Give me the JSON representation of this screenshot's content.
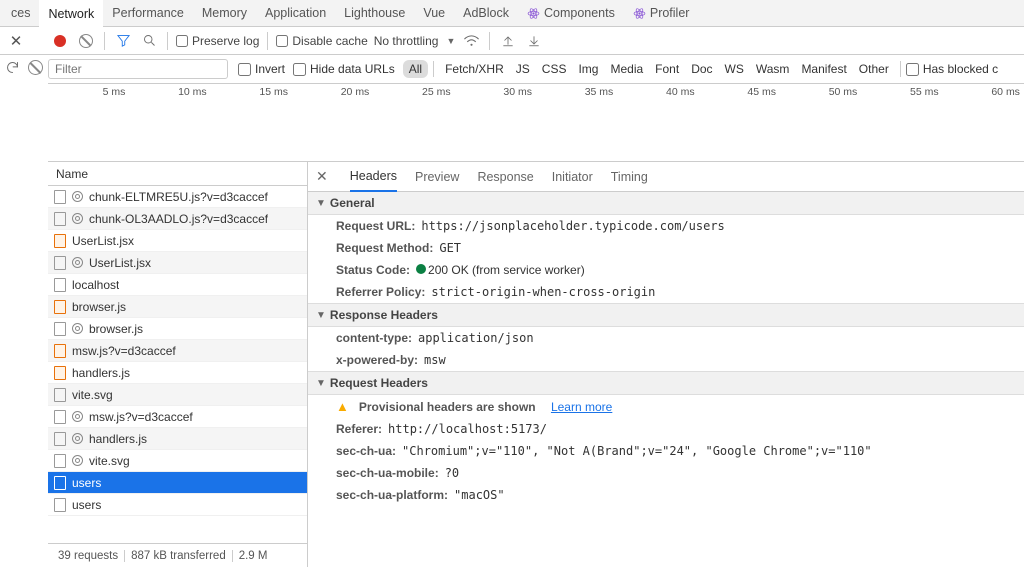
{
  "topTabs": {
    "t0": "ces",
    "t1": "Network",
    "t2": "Performance",
    "t3": "Memory",
    "t4": "Application",
    "t5": "Lighthouse",
    "t6": "Vue",
    "t7": "AdBlock",
    "t8": "Components",
    "t9": "Profiler"
  },
  "toolbar": {
    "preserve": "Preserve log",
    "disableCache": "Disable cache",
    "throttling": "No throttling"
  },
  "filter": {
    "placeholder": "Filter",
    "invert": "Invert",
    "hideData": "Hide data URLs",
    "types": {
      "all": "All",
      "fx": "Fetch/XHR",
      "js": "JS",
      "css": "CSS",
      "img": "Img",
      "media": "Media",
      "font": "Font",
      "doc": "Doc",
      "ws": "WS",
      "wasm": "Wasm",
      "manifest": "Manifest",
      "other": "Other"
    },
    "blocked": "Has blocked c"
  },
  "ticks": {
    "t1": "5 ms",
    "t2": "10 ms",
    "t3": "15 ms",
    "t4": "20 ms",
    "t5": "25 ms",
    "t6": "30 ms",
    "t7": "35 ms",
    "t8": "40 ms",
    "t9": "45 ms",
    "t10": "50 ms",
    "t11": "55 ms",
    "t12": "60 ms"
  },
  "reqHeader": "Name",
  "reqs": {
    "r0": "chunk-ELTMRE5U.js?v=d3caccef",
    "r1": "chunk-OL3AADLO.js?v=d3caccef",
    "r2": "UserList.jsx",
    "r3": "UserList.jsx",
    "r4": "localhost",
    "r5": "browser.js",
    "r6": "browser.js",
    "r7": "msw.js?v=d3caccef",
    "r8": "handlers.js",
    "r9": "vite.svg",
    "r10": "msw.js?v=d3caccef",
    "r11": "handlers.js",
    "r12": "vite.svg",
    "r13": "users",
    "r14": "users"
  },
  "footer": {
    "count": "39 requests",
    "xfer": "887 kB transferred",
    "more": "2.9 M"
  },
  "detailTabs": {
    "headers": "Headers",
    "preview": "Preview",
    "response": "Response",
    "initiator": "Initiator",
    "timing": "Timing"
  },
  "sections": {
    "general": "General",
    "resp": "Response Headers",
    "req": "Request Headers"
  },
  "general": {
    "urlK": "Request URL:",
    "urlV": "https://jsonplaceholder.typicode.com/users",
    "methodK": "Request Method:",
    "methodV": "GET",
    "statusK": "Status Code:",
    "statusV": "200 OK (from service worker)",
    "refK": "Referrer Policy:",
    "refV": "strict-origin-when-cross-origin"
  },
  "respH": {
    "ctK": "content-type:",
    "ctV": "application/json",
    "xpK": "x-powered-by:",
    "xpV": "msw"
  },
  "reqH": {
    "prov": "Provisional headers are shown",
    "learn": "Learn more",
    "refK": "Referer:",
    "refV": "http://localhost:5173/",
    "uaK": "sec-ch-ua:",
    "uaV": "\"Chromium\";v=\"110\", \"Not A(Brand\";v=\"24\", \"Google Chrome\";v=\"110\"",
    "mobK": "sec-ch-ua-mobile:",
    "mobV": "?0",
    "platK": "sec-ch-ua-platform:",
    "platV": "\"macOS\""
  }
}
